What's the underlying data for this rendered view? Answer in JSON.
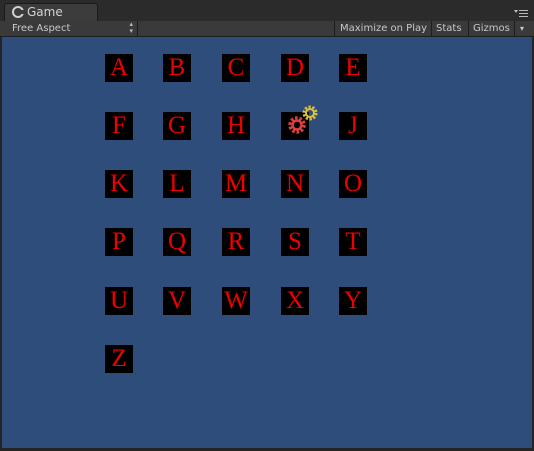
{
  "tab": {
    "title": "Game",
    "icon": "unity-icon"
  },
  "toolbar": {
    "aspect": "Free Aspect",
    "maximize": "Maximize on Play",
    "stats": "Stats",
    "gizmos": "Gizmos"
  },
  "viewport": {
    "letters": [
      "A",
      "B",
      "C",
      "D",
      "E",
      "F",
      "G",
      "H",
      "",
      "J",
      "K",
      "L",
      "M",
      "N",
      "O",
      "P",
      "Q",
      "R",
      "S",
      "T",
      "U",
      "V",
      "W",
      "X",
      "Y",
      "Z"
    ],
    "gizmo_icon": "gear-icon",
    "colors": {
      "background": "#2f4d7a",
      "letter": "#ee0000",
      "tile": "#000000"
    }
  }
}
